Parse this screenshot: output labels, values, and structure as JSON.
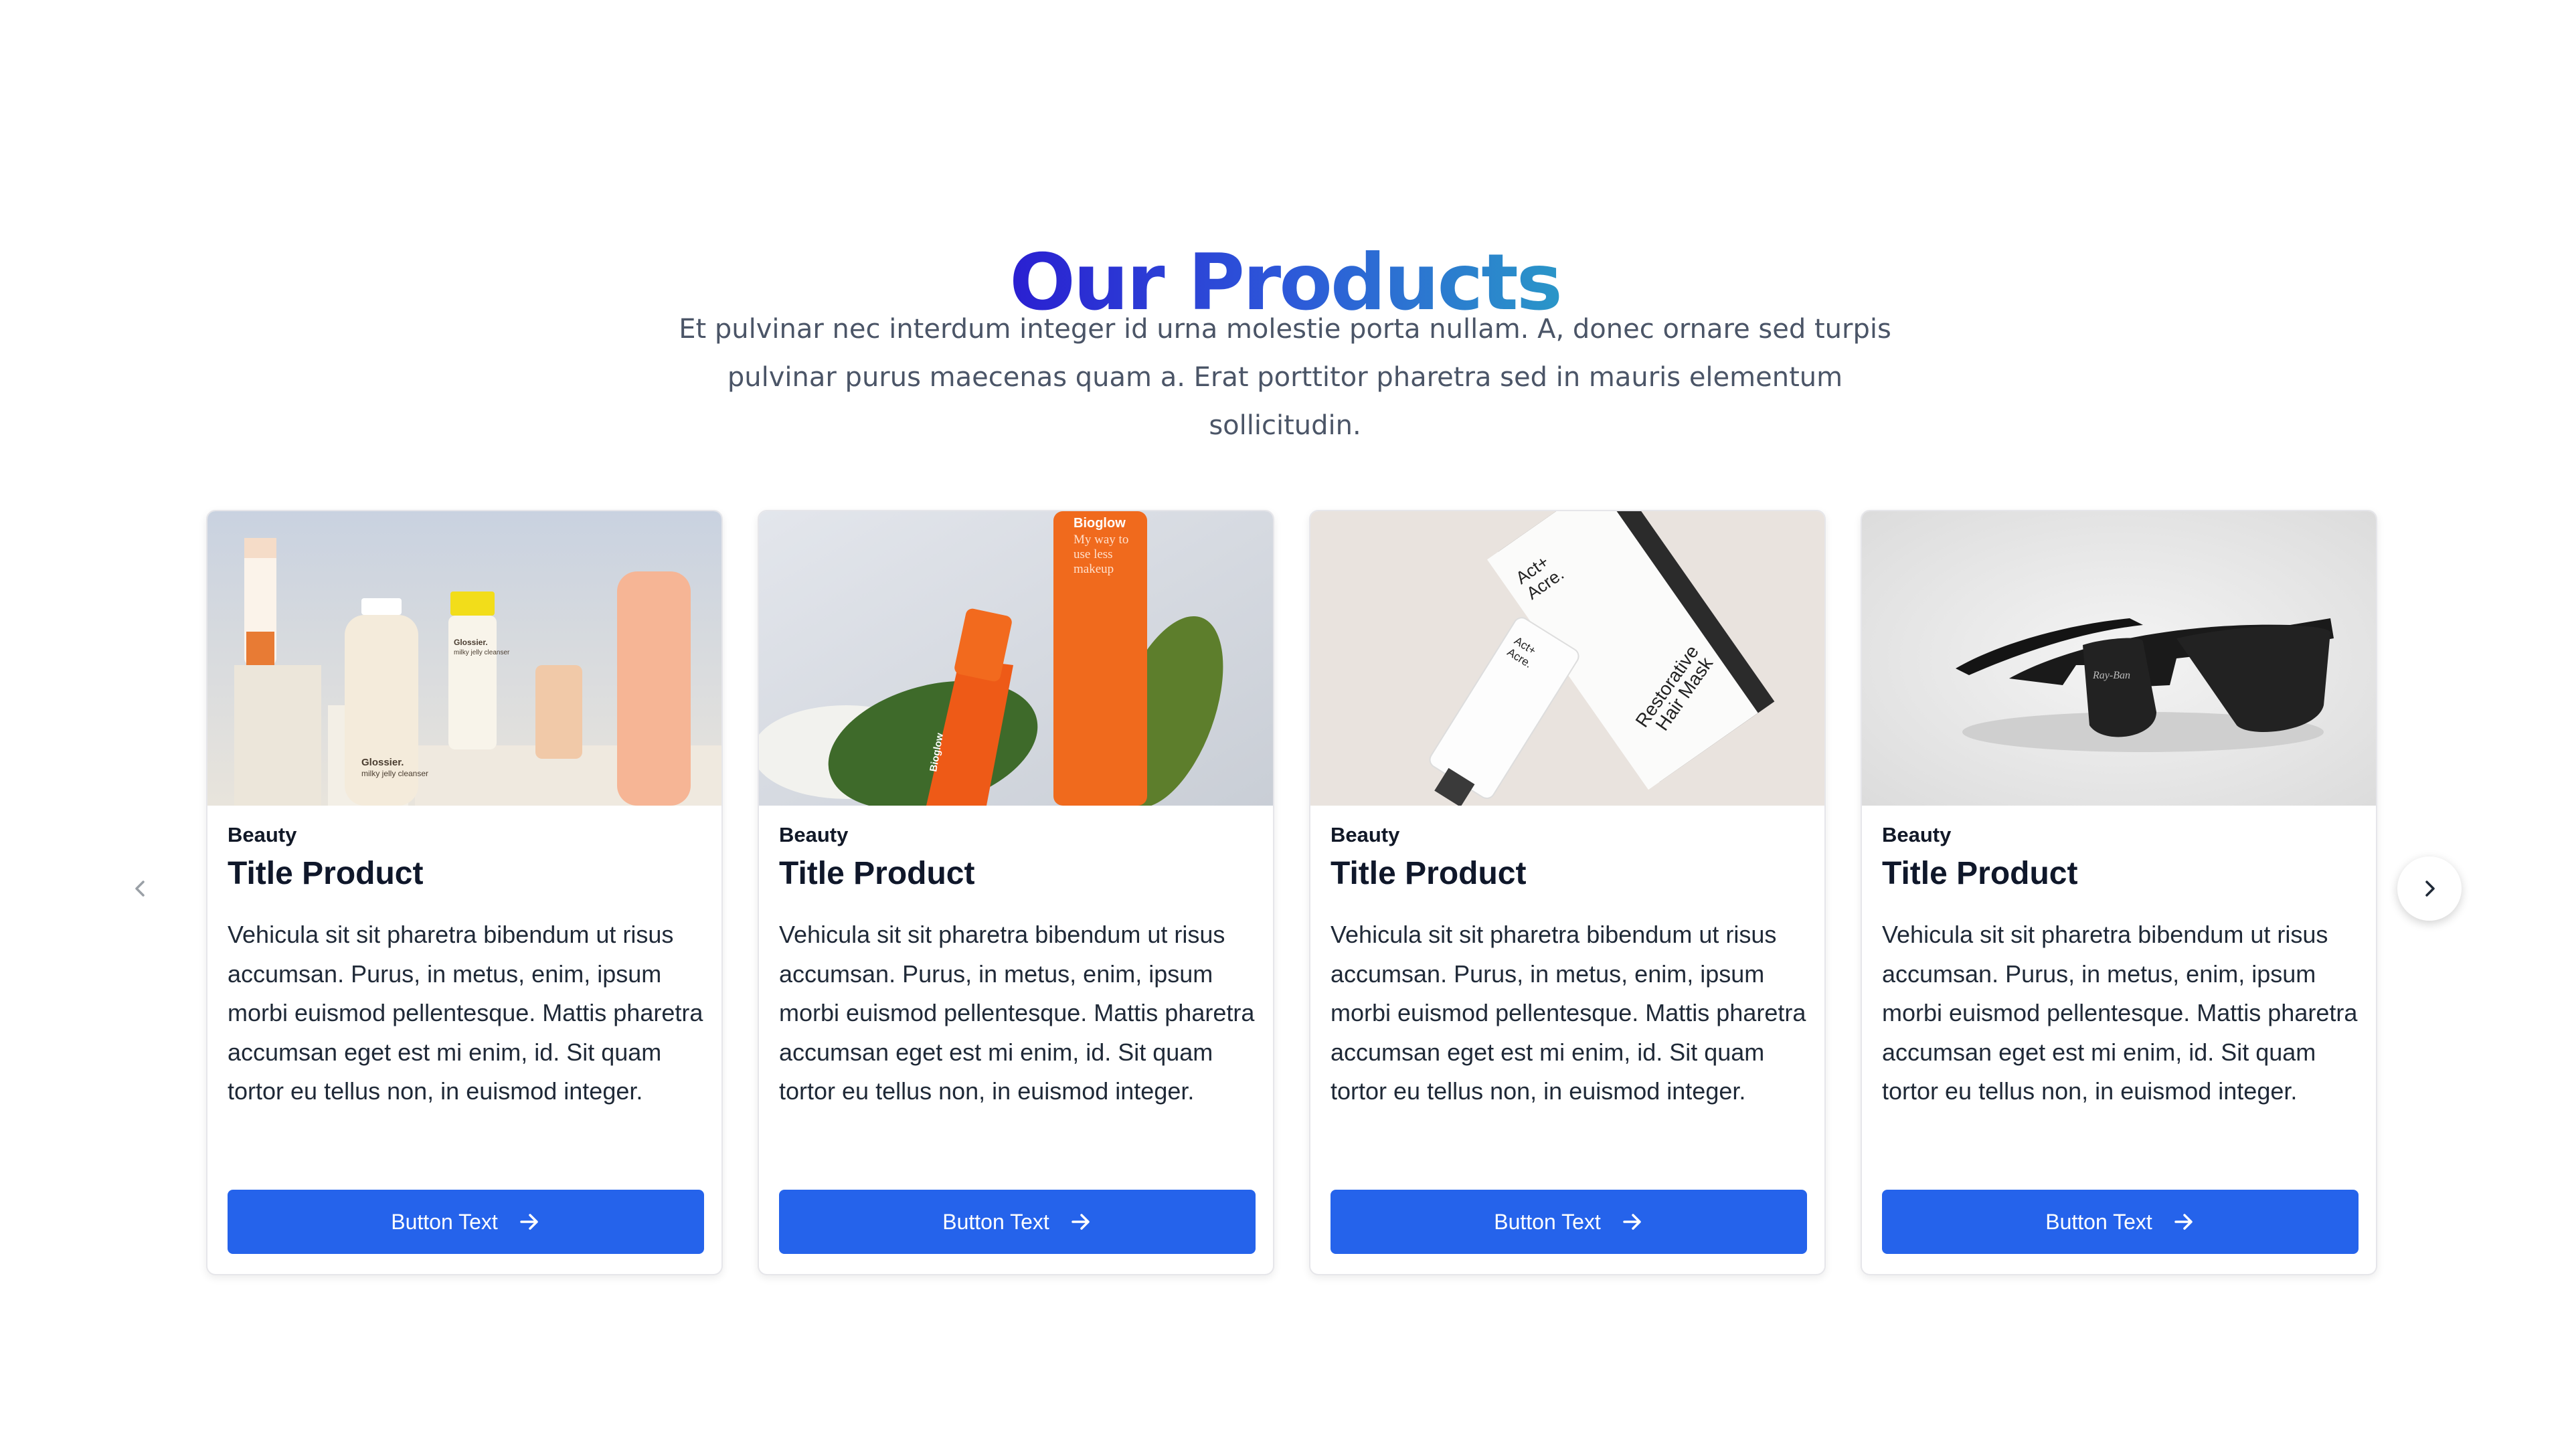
{
  "section": {
    "title": "Our Products",
    "subtitle_line1": "Et pulvinar nec interdum integer id urna molestie porta nullam. A, donec ornare sed turpis",
    "subtitle_line2": "pulvinar purus maecenas quam a. Erat porttitor pharetra sed in mauris elementum sollicitudin."
  },
  "carousel": {
    "prev_icon": "chevron-left-icon",
    "next_icon": "chevron-right-icon"
  },
  "products": [
    {
      "category": "Beauty",
      "title": "Title Product",
      "description": "Vehicula sit sit pharetra bibendum ut risus accumsan. Purus, in metus, enim, ipsum morbi euismod pellentesque. Mattis pharetra accumsan eget est mi enim, id. Sit quam tortor eu tellus non, in euismod integer.",
      "button_label": "Button Text",
      "image_text": [
        "Glossier.",
        "milky jelly cleanser",
        "Glossier.",
        "milky jelly cleanser"
      ]
    },
    {
      "category": "Beauty",
      "title": "Title Product",
      "description": "Vehicula sit sit pharetra bibendum ut risus accumsan. Purus, in metus, enim, ipsum morbi euismod pellentesque. Mattis pharetra accumsan eget est mi enim, id. Sit quam tortor eu tellus non, in euismod integer.",
      "button_label": "Button Text",
      "image_text": [
        "Bioglow",
        "My way to",
        "use less",
        "makeup",
        "Bioglow"
      ]
    },
    {
      "category": "Beauty",
      "title": "Title Product",
      "description": "Vehicula sit sit pharetra bibendum ut risus accumsan. Purus, in metus, enim, ipsum morbi euismod pellentesque. Mattis pharetra accumsan eget est mi enim, id. Sit quam tortor eu tellus non, in euismod integer.",
      "button_label": "Button Text",
      "image_text": [
        "Act+",
        "Acre.",
        "Restorative",
        "Hair Mask",
        "Act+",
        "Acre."
      ]
    },
    {
      "category": "Beauty",
      "title": "Title Product",
      "description": "Vehicula sit sit pharetra bibendum ut risus accumsan. Purus, in metus, enim, ipsum morbi euismod pellentesque. Mattis pharetra accumsan eget est mi enim, id. Sit quam tortor eu tellus non, in euismod integer.",
      "button_label": "Button Text",
      "image_text": [
        "Ray-Ban"
      ]
    }
  ],
  "colors": {
    "button": "#2563eb",
    "title_gradient_start": "#2a1fd1",
    "title_gradient_end": "#2a96c8",
    "subtitle": "#4b5567"
  }
}
